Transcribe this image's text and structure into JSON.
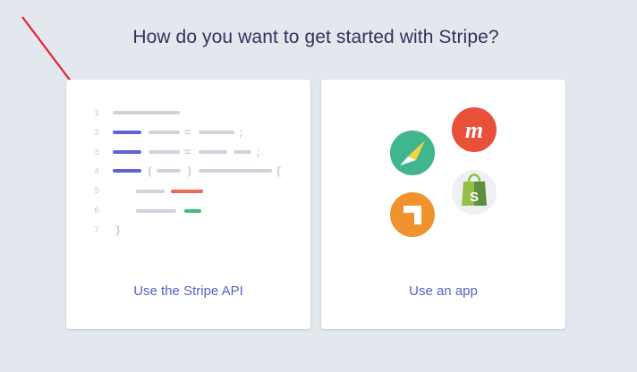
{
  "heading": "How do you want to get started with Stripe?",
  "cards": {
    "api": {
      "label": "Use the Stripe API"
    },
    "app": {
      "label": "Use an app"
    }
  },
  "code_illustration": {
    "line_numbers": [
      "1",
      "2",
      "3",
      "4",
      "5",
      "6",
      "7"
    ],
    "symbols": {
      "equals": "=",
      "semicolon": ";",
      "open_paren": "(",
      "close_paren": ")",
      "open_brace": "{",
      "close_brace": "}"
    }
  },
  "app_icons": [
    {
      "name": "compass-icon",
      "color": "#3fb68e"
    },
    {
      "name": "m-logo-icon",
      "color": "#e8503a",
      "glyph": "m"
    },
    {
      "name": "shopify-bag-icon",
      "color": "#eef0f4",
      "glyph": "S"
    },
    {
      "name": "arrow-app-icon",
      "color": "#f0922e"
    }
  ],
  "colors": {
    "accent": "#5a61c6",
    "annotation_arrow": "#e8202a",
    "code_blue": "#5d64d4",
    "code_red": "#e66a55",
    "code_green": "#3fbf7f",
    "code_gray": "#cfd3db"
  }
}
